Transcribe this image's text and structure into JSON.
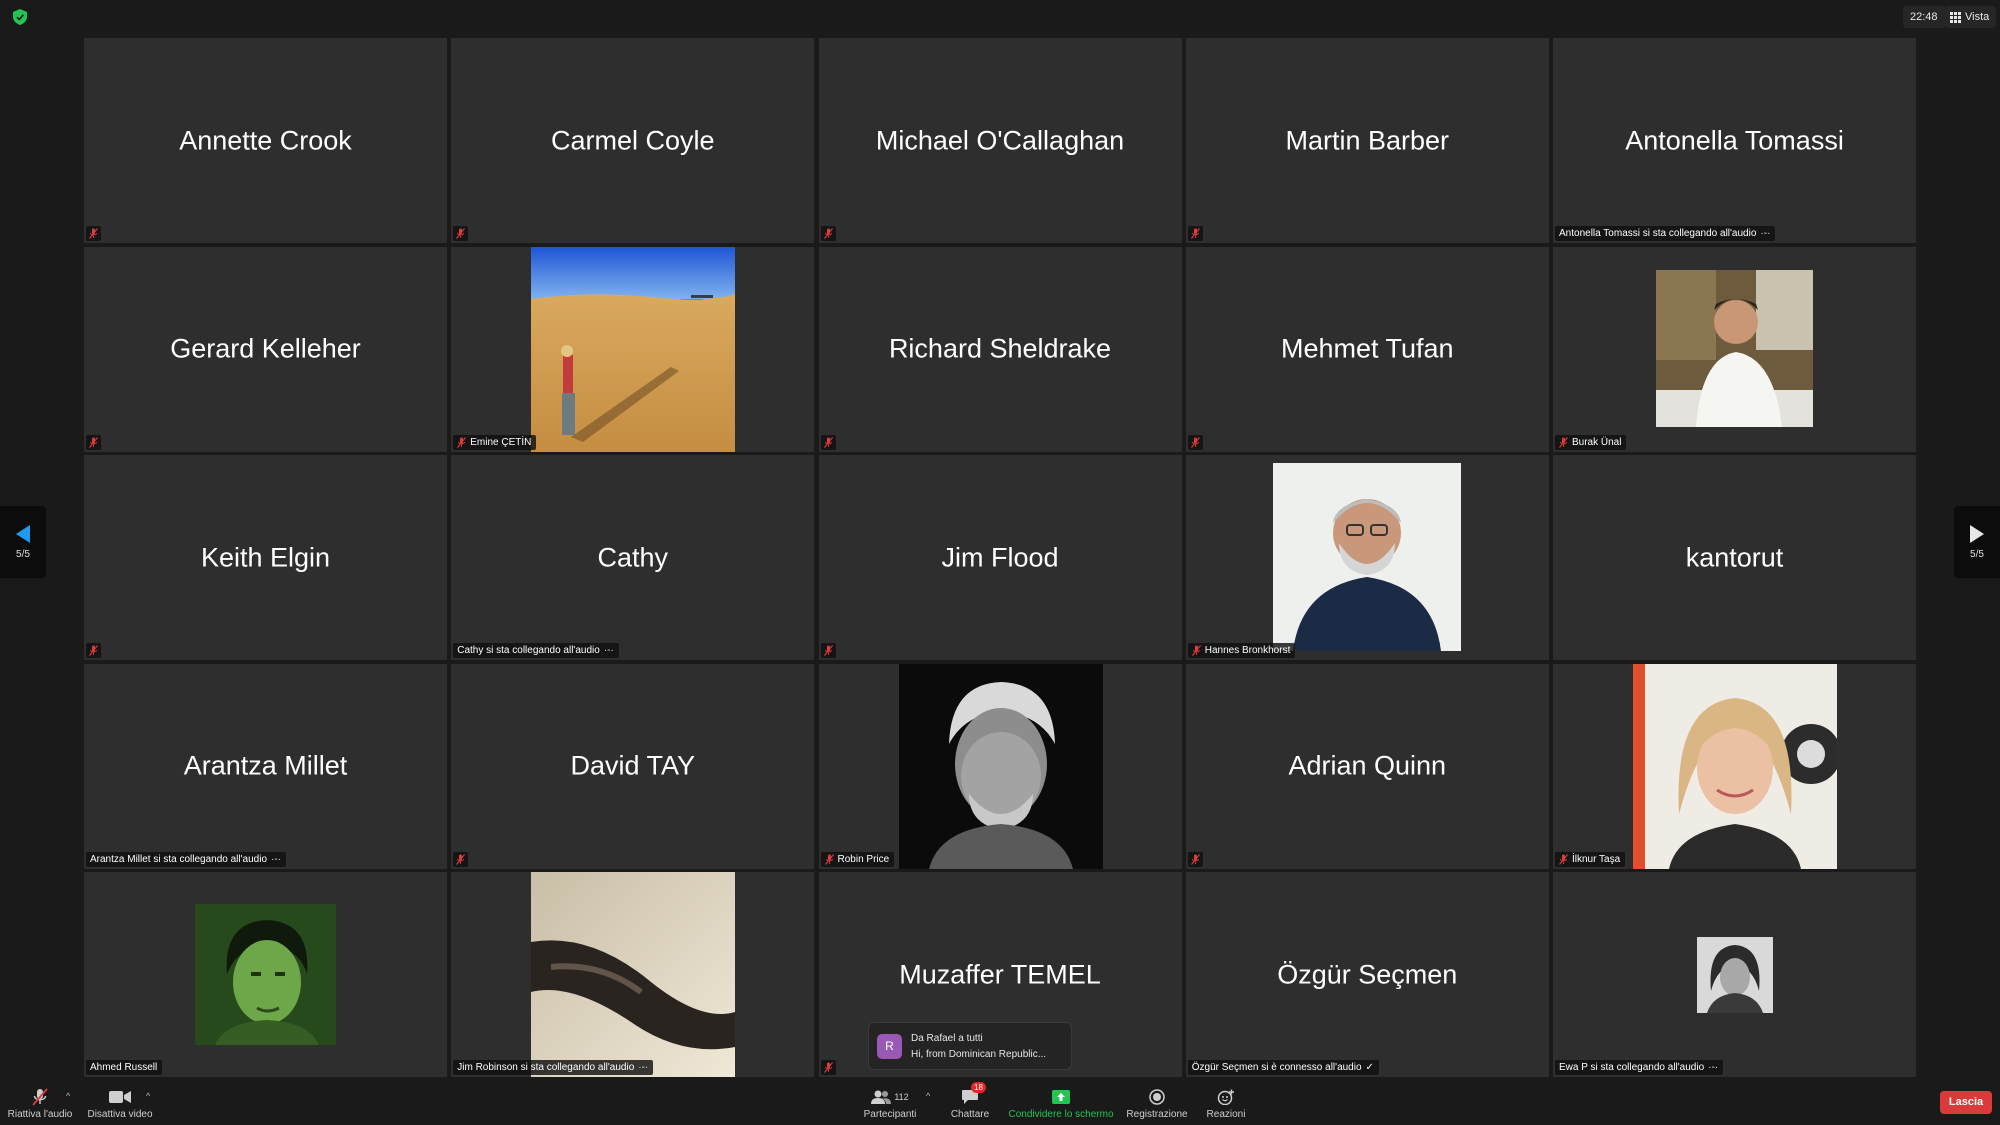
{
  "topbar": {
    "time": "22:48",
    "view_label": "Vista",
    "icons": {
      "security": "shield-check-icon",
      "view": "grid-icon"
    }
  },
  "pagination": {
    "left": "5/5",
    "right": "5/5"
  },
  "tiles": [
    {
      "name": "Annette Crook",
      "muted": true
    },
    {
      "name": "Carmel Coyle",
      "muted": true
    },
    {
      "name": "Michael O'Callaghan",
      "muted": true
    },
    {
      "name": "Martin Barber",
      "muted": true
    },
    {
      "name": "Antonella Tomassi",
      "label": "Antonella Tomassi si sta collegando all'audio",
      "connecting": true
    },
    {
      "name": "Gerard Kelleher",
      "muted": true
    },
    {
      "label": "Emine ÇETİN",
      "muted": true,
      "image": "desert-photo"
    },
    {
      "name": "Richard Sheldrake",
      "muted": true
    },
    {
      "name": "Mehmet Tufan",
      "muted": true
    },
    {
      "label": "Burak Ünal",
      "muted": true,
      "image": "man-white-shirt-photo"
    },
    {
      "name": "Keith Elgin",
      "muted": true
    },
    {
      "name": "Cathy",
      "label": "Cathy si sta collegando all'audio",
      "connecting": true
    },
    {
      "name": "Jim Flood",
      "muted": true
    },
    {
      "label": "Hannes Bronkhorst",
      "muted": true,
      "image": "bearded-man-photo"
    },
    {
      "name": "kantorut"
    },
    {
      "name": "Arantza Millet",
      "label": "Arantza Millet si sta collegando all'audio",
      "connecting": true
    },
    {
      "name": "David TAY",
      "muted": true
    },
    {
      "label": "Robin Price",
      "muted": true,
      "image": "bw-portrait-photo"
    },
    {
      "name": "Adrian Quinn",
      "muted": true
    },
    {
      "label": "İlknur Taşa",
      "muted": true,
      "image": "blonde-woman-photo"
    },
    {
      "label": "Ahmed Russell",
      "image": "green-portrait-photo"
    },
    {
      "label": "Jim Robinson si sta collegando all'audio",
      "connecting": true,
      "image": "sepia-abstract-photo"
    },
    {
      "name": "Muzaffer TEMEL",
      "muted": true
    },
    {
      "name": "Özgür Seçmen",
      "label": "Özgür Seçmen si è connesso all'audio",
      "connected": true
    },
    {
      "label": "Ewa P si sta collegando all'audio",
      "connecting": true,
      "image": "small-woman-portrait-photo"
    }
  ],
  "chat_preview": {
    "avatar_letter": "R",
    "from": "Da Rafael a tutti",
    "message": "Hi, from Dominican Republic..."
  },
  "toolbar": {
    "unmute_label": "Riattiva l'audio",
    "video_label": "Disattiva video",
    "participants_label": "Partecipanti",
    "participants_count": "112",
    "chat_label": "Chattare",
    "chat_badge": "18",
    "share_label": "Condividere lo schermo",
    "record_label": "Registrazione",
    "reactions_label": "Reazioni",
    "leave_label": "Lascia"
  },
  "colors": {
    "background": "#1a1a1a",
    "tile": "#2e2e2e",
    "share_green": "#23c552",
    "leave_red": "#d93a3a",
    "mute_red": "#e03a3a",
    "chat_avatar": "#9b59b6"
  }
}
